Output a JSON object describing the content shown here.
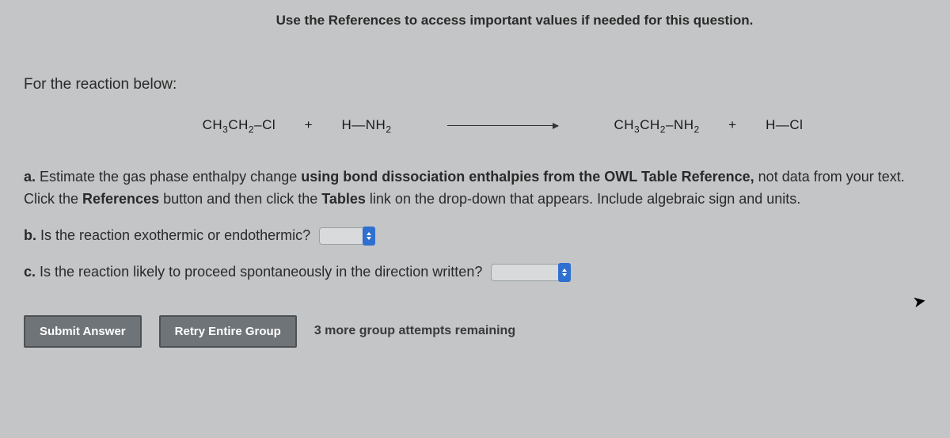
{
  "header": {
    "instruction": "Use the References to access important values if needed for this question."
  },
  "intro": "For the reaction below:",
  "reaction": {
    "r1_a": "CH",
    "r1_b": "CH",
    "r1_c": "Cl",
    "plus": "+",
    "r2_a": "H",
    "r2_b": "NH",
    "p1_a": "CH",
    "p1_b": "CH",
    "p1_c": "NH",
    "p2_a": "H",
    "p2_b": "Cl"
  },
  "parts": {
    "a": {
      "label": "a.",
      "t1": " Estimate the gas phase enthalpy change ",
      "t2": "using bond dissociation enthalpies from the OWL Table Reference,",
      "t3": " not data from your text. Click the ",
      "t4": "References",
      "t5": " button and then click the ",
      "t6": "Tables",
      "t7": " link on the drop-down that appears. Include algebraic sign and units."
    },
    "b": {
      "label": "b.",
      "text": " Is the reaction exothermic or endothermic?"
    },
    "c": {
      "label": "c.",
      "text": " Is the reaction likely to proceed spontaneously in the direction written?"
    }
  },
  "buttons": {
    "submit": "Submit Answer",
    "retry": "Retry Entire Group",
    "attempts": "3 more group attempts remaining"
  }
}
